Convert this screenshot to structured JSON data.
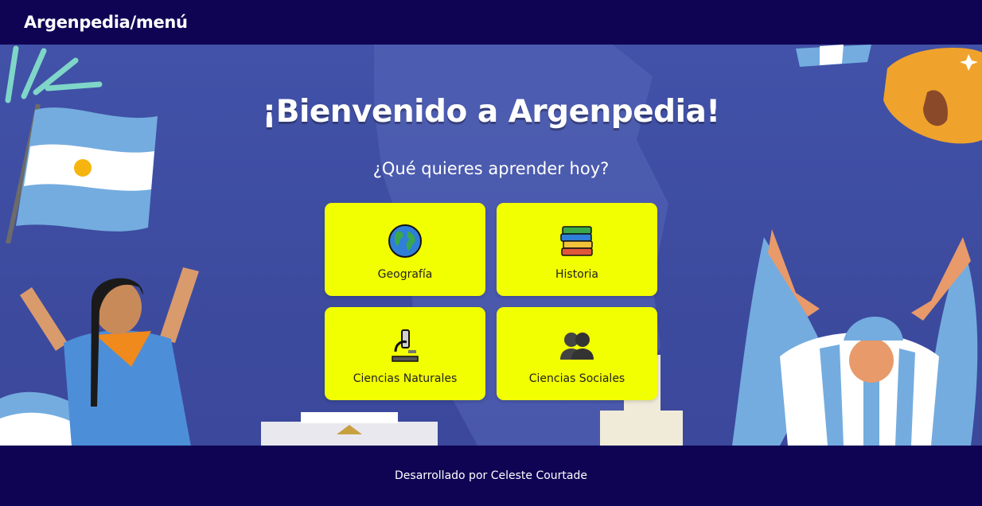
{
  "header": {
    "brand": "Argenpedia/menú"
  },
  "hero": {
    "title": "¡Bienvenido a Argenpedia!",
    "question": "¿Qué quieres aprender hoy?"
  },
  "menu": {
    "items": [
      {
        "label": "Geografía",
        "icon": "globe-icon"
      },
      {
        "label": "Historia",
        "icon": "books-icon"
      },
      {
        "label": "Ciencias Naturales",
        "icon": "microscope-icon"
      },
      {
        "label": "Ciencias Sociales",
        "icon": "people-icon"
      }
    ]
  },
  "footer": {
    "credit": "Desarrollado por Celeste Courtade"
  },
  "colors": {
    "nav": "#0f0454",
    "hero_bg": "#3d4aa0",
    "card": "#f2ff00",
    "flag_blue": "#74acdf"
  }
}
